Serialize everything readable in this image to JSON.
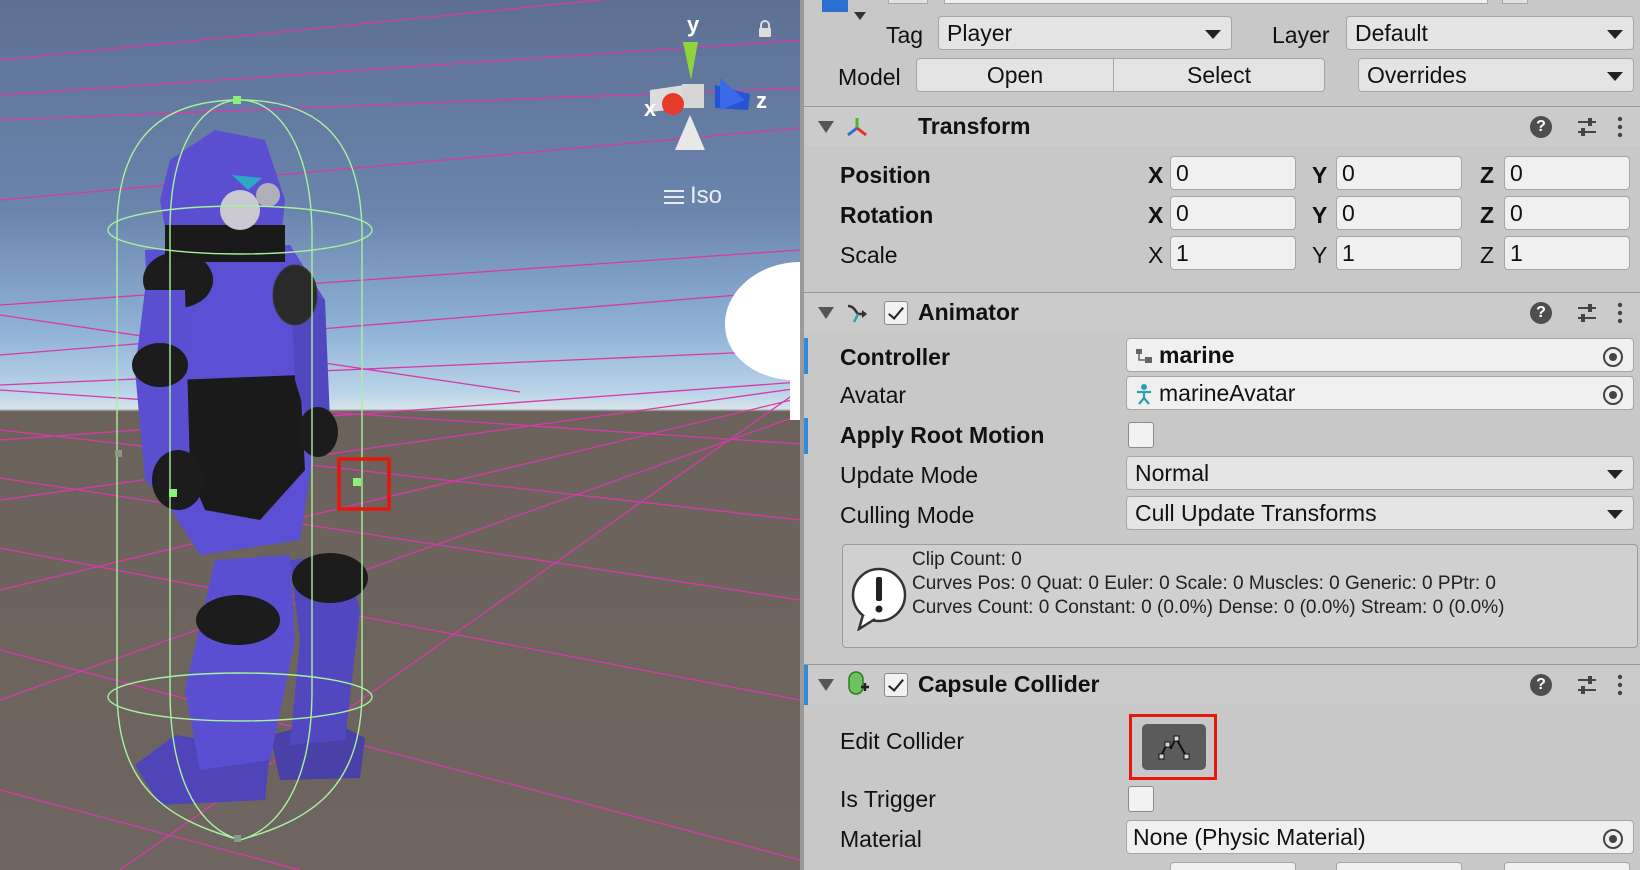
{
  "scene": {
    "gizmo": {
      "x_label": "x",
      "y_label": "y",
      "z_label": "z"
    },
    "projection_label": "Iso",
    "projection_icon": "hamburger-icon",
    "lock_icon": "lock-icon",
    "colors": {
      "grid": "#d63aa8",
      "collider": "#a8f0a0",
      "handle": "#8cf07a",
      "highlight": "#e8160c",
      "character": "#5a4fd0"
    }
  },
  "inspector": {
    "tag_label": "Tag",
    "tag_value": "Player",
    "layer_label": "Layer",
    "layer_value": "Default",
    "model_label": "Model",
    "model_open": "Open",
    "model_select": "Select",
    "model_overrides": "Overrides",
    "transform": {
      "title": "Transform",
      "position_label": "Position",
      "rotation_label": "Rotation",
      "scale_label": "Scale",
      "position": {
        "x": "0",
        "y": "0",
        "z": "0"
      },
      "rotation": {
        "x": "0",
        "y": "0",
        "z": "0"
      },
      "scale": {
        "x": "1",
        "y": "1",
        "z": "1"
      },
      "axis_x": "X",
      "axis_y": "Y",
      "axis_z": "Z"
    },
    "animator": {
      "title": "Animator",
      "enabled": true,
      "controller_label": "Controller",
      "controller_value": "marine",
      "avatar_label": "Avatar",
      "avatar_value": "marineAvatar",
      "apply_root_motion_label": "Apply Root Motion",
      "apply_root_motion": false,
      "update_mode_label": "Update Mode",
      "update_mode_value": "Normal",
      "culling_mode_label": "Culling Mode",
      "culling_mode_value": "Cull Update Transforms",
      "info": {
        "line1": "Clip Count: 0",
        "line2": "Curves Pos: 0 Quat: 0 Euler: 0 Scale: 0 Muscles: 0 Generic: 0 PPtr: 0",
        "line3": "Curves Count: 0 Constant: 0 (0.0%) Dense: 0 (0.0%) Stream: 0 (0.0%)"
      }
    },
    "capsule_collider": {
      "title": "Capsule Collider",
      "enabled": true,
      "edit_collider_label": "Edit Collider",
      "is_trigger_label": "Is Trigger",
      "is_trigger": false,
      "material_label": "Material",
      "material_value": "None (Physic Material)"
    }
  }
}
